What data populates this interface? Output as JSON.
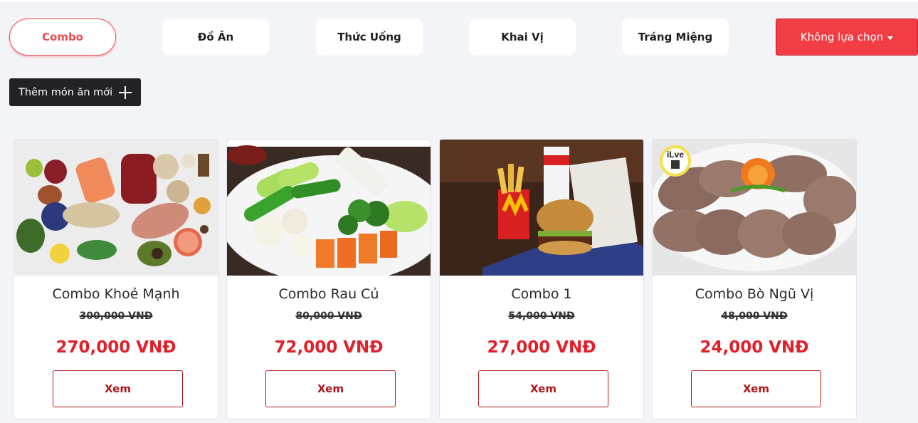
{
  "categories": {
    "tabs": [
      {
        "label": "Combo",
        "active": true
      },
      {
        "label": "Đồ Ăn",
        "active": false
      },
      {
        "label": "Thức Uống",
        "active": false
      },
      {
        "label": "Khai Vị",
        "active": false
      },
      {
        "label": "Tráng Miệng",
        "active": false
      }
    ],
    "dropdown_label": "Không lựa chọn"
  },
  "toolbar": {
    "add_label": "Thêm món ăn mới"
  },
  "products": [
    {
      "name": "Combo Khoẻ Mạnh",
      "old_price": "300,000 VNĐ",
      "price": "270,000 VNĐ",
      "button": "Xem",
      "image": "healthy-food-photo"
    },
    {
      "name": "Combo Rau Củ",
      "old_price": "80,000 VNĐ",
      "price": "72,000 VNĐ",
      "button": "Xem",
      "image": "vegetable-platter-photo"
    },
    {
      "name": "Combo 1",
      "old_price": "54,000 VNĐ",
      "price": "27,000 VNĐ",
      "button": "Xem",
      "image": "burger-meal-photo"
    },
    {
      "name": "Combo Bò Ngũ Vị",
      "old_price": "48,000 VNĐ",
      "price": "24,000 VNĐ",
      "button": "Xem",
      "image": "sliced-beef-photo"
    }
  ],
  "watermark": "iLve",
  "colors": {
    "accent": "#ee4a4f",
    "dropdown_bg": "#f23d45",
    "price": "#e0202a",
    "button_border": "#b0151c",
    "dark_button": "#232226",
    "background": "#f3f4f8"
  }
}
